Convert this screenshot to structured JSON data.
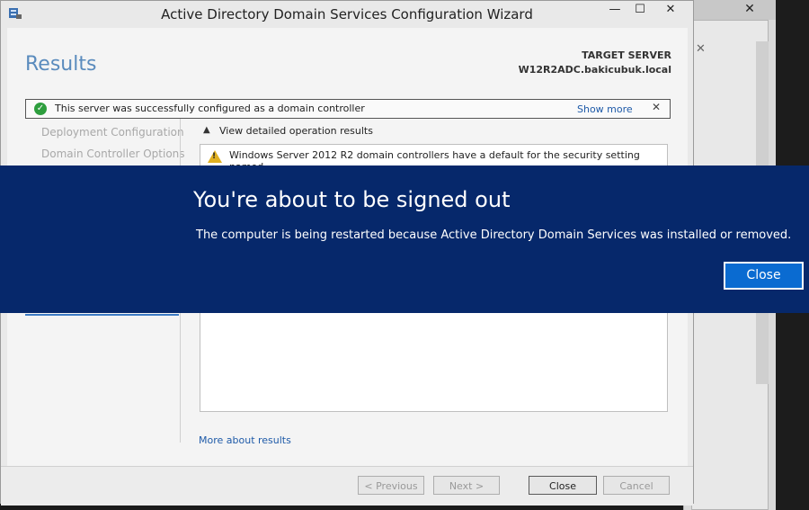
{
  "wizard": {
    "title": "Active Directory Domain Services Configuration Wizard",
    "page_heading": "Results",
    "target_label": "TARGET SERVER",
    "target_value": "W12R2ADC.bakicubuk.local",
    "success_message": "This server was successfully configured as a domain controller",
    "show_more": "Show more",
    "nav": [
      "Deployment Configuration",
      "Domain Controller Options"
    ],
    "view_detailed": "View detailed operation results",
    "warning_text": "Windows Server 2012 R2 domain controllers have a default for the security setting named",
    "more_about": "More about results",
    "buttons": {
      "previous": "< Previous",
      "next": "Next >",
      "close": "Close",
      "cancel": "Cancel"
    }
  },
  "signout": {
    "title": "You're about to be signed out",
    "message": "The computer is being restarted because Active Directory Domain Services was installed or removed.",
    "close": "Close"
  }
}
